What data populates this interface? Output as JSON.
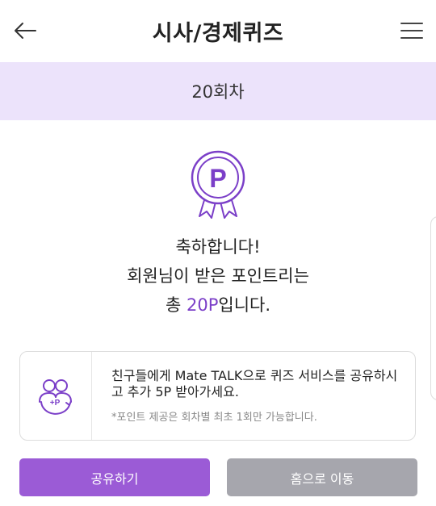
{
  "header": {
    "title": "시사/경제퀴즈",
    "back_icon": "arrow-left-icon",
    "menu_icon": "hamburger-menu-icon"
  },
  "round": {
    "label": "20회차"
  },
  "badge": {
    "icon": "point-medal-icon",
    "letter": "P"
  },
  "result": {
    "line1": "축하합니다!",
    "line2": "회원님이 받은 포인트리는",
    "line3_prefix": "총 ",
    "points": "20P",
    "line3_suffix": "입니다."
  },
  "share_card": {
    "icon": "friends-plus-point-icon",
    "icon_text": "+P",
    "main_text": "친구들에게 Mate TALK으로 퀴즈 서비스를 공유하시고 추가 5P 받아가세요.",
    "note": "*포인트 제공은 회차별 최초 1회만 가능합니다."
  },
  "buttons": {
    "share_label": "공유하기",
    "home_label": "홈으로 이동"
  },
  "colors": {
    "accent": "#9b5bd6",
    "round_bar_bg": "#ece3fb",
    "points_text": "#7b3fc8",
    "disabled_button": "#a6a6ad"
  }
}
